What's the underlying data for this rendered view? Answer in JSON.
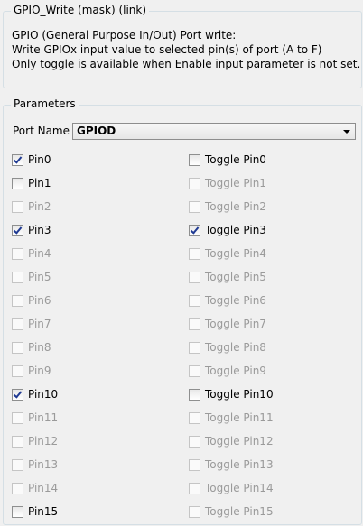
{
  "description_group": {
    "title": "GPIO_Write (mask) (link)",
    "lines": [
      "GPIO (General Purpose In/Out) Port write:",
      "Write GPIOx input value to selected pin(s) of port (A to F)",
      "Only toggle is available when Enable input parameter is not set."
    ]
  },
  "parameters_group": {
    "title": "Parameters",
    "port_name_label": "Port Name",
    "port_name_value": "GPIOD"
  },
  "pins": [
    {
      "label": "Pin0",
      "checked": true,
      "enabled": true
    },
    {
      "label": "Pin1",
      "checked": false,
      "enabled": true
    },
    {
      "label": "Pin2",
      "checked": false,
      "enabled": false
    },
    {
      "label": "Pin3",
      "checked": true,
      "enabled": true
    },
    {
      "label": "Pin4",
      "checked": false,
      "enabled": false
    },
    {
      "label": "Pin5",
      "checked": false,
      "enabled": false
    },
    {
      "label": "Pin6",
      "checked": false,
      "enabled": false
    },
    {
      "label": "Pin7",
      "checked": false,
      "enabled": false
    },
    {
      "label": "Pin8",
      "checked": false,
      "enabled": false
    },
    {
      "label": "Pin9",
      "checked": false,
      "enabled": false
    },
    {
      "label": "Pin10",
      "checked": true,
      "enabled": true
    },
    {
      "label": "Pin11",
      "checked": false,
      "enabled": false
    },
    {
      "label": "Pin12",
      "checked": false,
      "enabled": false
    },
    {
      "label": "Pin13",
      "checked": false,
      "enabled": false
    },
    {
      "label": "Pin14",
      "checked": false,
      "enabled": false
    },
    {
      "label": "Pin15",
      "checked": false,
      "enabled": true
    }
  ],
  "toggles": [
    {
      "label": "Toggle Pin0",
      "checked": false,
      "enabled": true
    },
    {
      "label": "Toggle Pin1",
      "checked": false,
      "enabled": false
    },
    {
      "label": "Toggle Pin2",
      "checked": false,
      "enabled": false
    },
    {
      "label": "Toggle Pin3",
      "checked": true,
      "enabled": true
    },
    {
      "label": "Toggle Pin4",
      "checked": false,
      "enabled": false
    },
    {
      "label": "Toggle Pin5",
      "checked": false,
      "enabled": false
    },
    {
      "label": "Toggle Pin6",
      "checked": false,
      "enabled": false
    },
    {
      "label": "Toggle Pin7",
      "checked": false,
      "enabled": false
    },
    {
      "label": "Toggle Pin8",
      "checked": false,
      "enabled": false
    },
    {
      "label": "Toggle Pin9",
      "checked": false,
      "enabled": false
    },
    {
      "label": "Toggle Pin10",
      "checked": false,
      "enabled": true
    },
    {
      "label": "Toggle Pin11",
      "checked": false,
      "enabled": false
    },
    {
      "label": "Toggle Pin12",
      "checked": false,
      "enabled": false
    },
    {
      "label": "Toggle Pin13",
      "checked": false,
      "enabled": false
    },
    {
      "label": "Toggle Pin14",
      "checked": false,
      "enabled": false
    },
    {
      "label": "Toggle Pin15",
      "checked": false,
      "enabled": false
    }
  ],
  "colors": {
    "background": "#f0f0f0",
    "group_border": "#d5dfe5",
    "disabled_text": "#9a9a9a",
    "check_mark": "#1f3a93"
  }
}
